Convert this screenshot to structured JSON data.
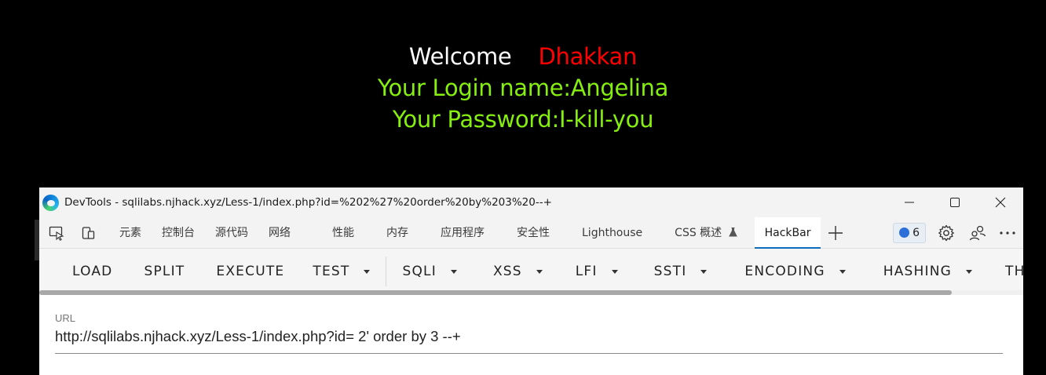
{
  "page": {
    "welcome": "Welcome",
    "user": "Dhakkan",
    "login_line": "Your Login name:Angelina",
    "password_line": "Your Password:I-kill-you"
  },
  "devtools": {
    "title": "DevTools - sqlilabs.njhack.xyz/Less-1/index.php?id=%202%27%20order%20by%203%20--+",
    "window_controls": {
      "minimize": "minimize-icon",
      "maximize": "maximize-icon",
      "close": "close-icon"
    },
    "toolbar_icons": [
      "inspect-icon",
      "device-toolbar-icon"
    ],
    "tabs": [
      "元素",
      "控制台",
      "源代码",
      "网络",
      "性能",
      "内存",
      "应用程序",
      "安全性",
      "Lighthouse",
      "CSS 概述",
      "HackBar"
    ],
    "active_tab": "HackBar",
    "issues_count": "6",
    "accent_color": "#0f6cbd"
  },
  "hackbar": {
    "buttons": [
      "LOAD",
      "SPLIT",
      "EXECUTE"
    ],
    "dropdowns": [
      "TEST",
      "SQLI",
      "XSS",
      "LFI",
      "SSTI",
      "ENCODING",
      "HASHING",
      "TH"
    ],
    "url_label": "URL",
    "url_value": "http://sqlilabs.njhack.xyz/Less-1/index.php?id= 2' order by 3 --+"
  },
  "colors": {
    "background": "#000000",
    "welcome": "#ffffff",
    "user": "#ff0000",
    "info": "#86ef0e"
  }
}
